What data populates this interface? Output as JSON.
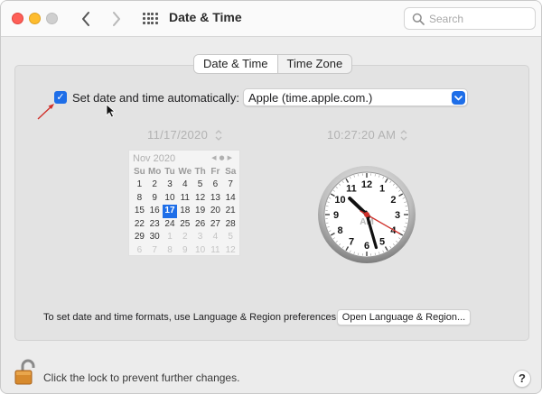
{
  "window": {
    "title": "Date & Time",
    "search_placeholder": "Search"
  },
  "tabs": [
    {
      "label": "Date & Time",
      "active": true
    },
    {
      "label": "Time Zone",
      "active": false
    }
  ],
  "auto": {
    "checked": true,
    "label": "Set date and time automatically:",
    "server": "Apple (time.apple.com.)"
  },
  "date_field": "11/17/2020",
  "time_field": "10:27:20 AM",
  "calendar": {
    "month_label": "Nov 2020",
    "weekdays": [
      "Su",
      "Mo",
      "Tu",
      "We",
      "Th",
      "Fr",
      "Sa"
    ],
    "days": [
      {
        "n": "1"
      },
      {
        "n": "2"
      },
      {
        "n": "3"
      },
      {
        "n": "4"
      },
      {
        "n": "5"
      },
      {
        "n": "6"
      },
      {
        "n": "7"
      },
      {
        "n": "8"
      },
      {
        "n": "9"
      },
      {
        "n": "10"
      },
      {
        "n": "11"
      },
      {
        "n": "12"
      },
      {
        "n": "13"
      },
      {
        "n": "14"
      },
      {
        "n": "15"
      },
      {
        "n": "16"
      },
      {
        "n": "17",
        "selected": true
      },
      {
        "n": "18"
      },
      {
        "n": "19"
      },
      {
        "n": "20"
      },
      {
        "n": "21"
      },
      {
        "n": "22"
      },
      {
        "n": "23"
      },
      {
        "n": "24"
      },
      {
        "n": "25"
      },
      {
        "n": "26"
      },
      {
        "n": "27"
      },
      {
        "n": "28"
      },
      {
        "n": "29"
      },
      {
        "n": "30"
      },
      {
        "n": "1",
        "other": true
      },
      {
        "n": "2",
        "other": true
      },
      {
        "n": "3",
        "other": true
      },
      {
        "n": "4",
        "other": true
      },
      {
        "n": "5",
        "other": true
      },
      {
        "n": "6",
        "other": true
      },
      {
        "n": "7",
        "other": true
      },
      {
        "n": "8",
        "other": true
      },
      {
        "n": "9",
        "other": true
      },
      {
        "n": "10",
        "other": true
      },
      {
        "n": "11",
        "other": true
      },
      {
        "n": "12",
        "other": true
      }
    ]
  },
  "clock": {
    "numbers": [
      "12",
      "1",
      "2",
      "3",
      "4",
      "5",
      "6",
      "7",
      "8",
      "9",
      "10",
      "11"
    ],
    "ampm": "AM",
    "hours": 10,
    "minutes": 27,
    "seconds": 20,
    "second_hand_color": "#d0302a"
  },
  "footer": {
    "format_text": "To set date and time formats, use Language & Region preferences.",
    "open_button": "Open Language & Region...",
    "lock_text": "Click the lock to prevent further changes.",
    "help": "?"
  },
  "colors": {
    "accent": "#1e6ee8",
    "annotation": "#d0302a"
  }
}
